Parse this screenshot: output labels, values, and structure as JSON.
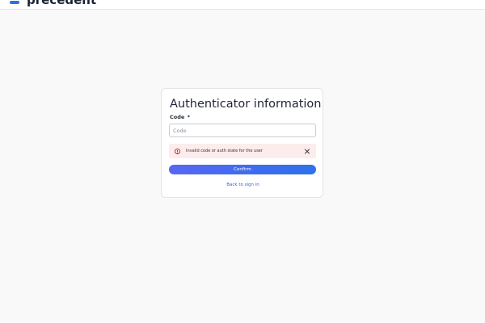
{
  "brand": {
    "name": "precedent",
    "logo_icon": "precedent-logo-icon",
    "accent_color": "#2f6fe4"
  },
  "form": {
    "title": "Authenticator information",
    "code_label": "Code",
    "required_marker": "*",
    "code_value": "",
    "code_placeholder": "Code",
    "error": {
      "icon": "alert-circle-icon",
      "message": "Invalid code or auth state for the user",
      "close_icon": "close-icon",
      "background": "#fcecec",
      "color": "#c62b2b"
    },
    "confirm_label": "Confirm",
    "back_link_label": "Back to sign in"
  }
}
